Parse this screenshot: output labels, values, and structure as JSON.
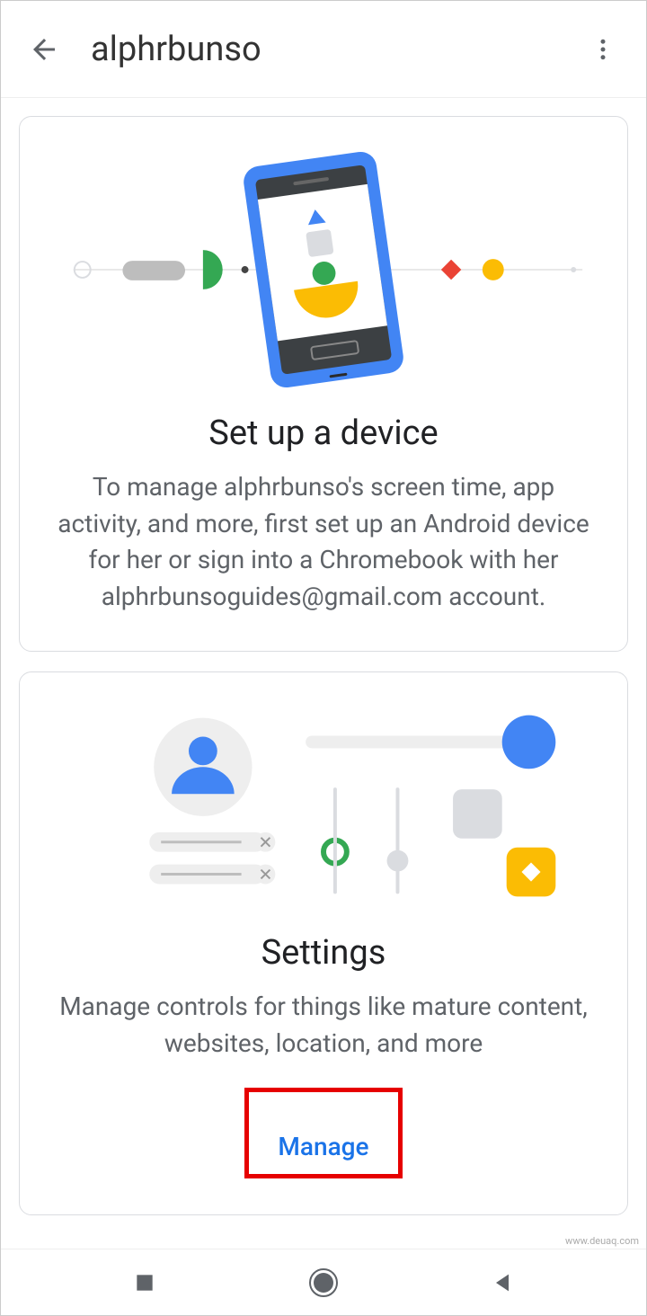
{
  "header": {
    "title": "alphrbunso"
  },
  "cards": {
    "setup": {
      "title": "Set up a device",
      "description": "To manage alphrbunso's screen time, app activity, and more, first set up an Android device for her or sign into a Chromebook with her alphrbunsoguides@gmail.com account."
    },
    "settings": {
      "title": "Settings",
      "description": "Manage controls for things like mature content, websites, location, and more",
      "button_label": "Manage"
    }
  },
  "watermark": "www.deuaq.com"
}
